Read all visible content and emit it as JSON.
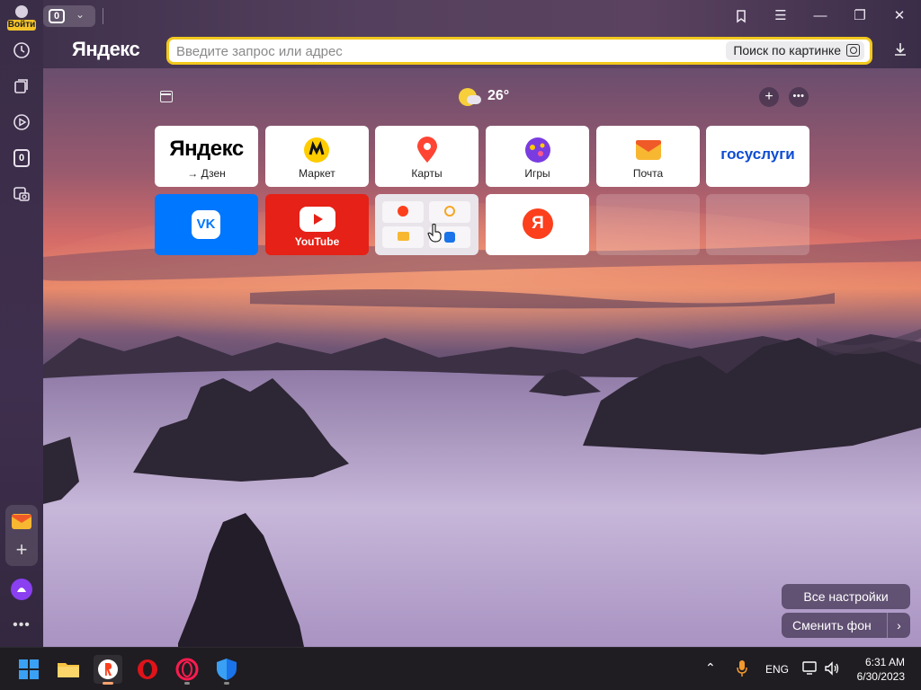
{
  "browser": {
    "login_label": "Войти",
    "tab_count": "0",
    "logo": "Яндекс",
    "search_placeholder": "Введите запрос или адрес",
    "image_search_label": "Поиск по картинке"
  },
  "sidebar": {
    "counter_badge": "0"
  },
  "newtab": {
    "weather_temp": "26°",
    "tiles": [
      {
        "logo": "Яндекс",
        "label": "→ Дзен"
      },
      {
        "label": "Маркет"
      },
      {
        "label": "Карты"
      },
      {
        "label": "Игры"
      },
      {
        "label": "Почта"
      },
      {
        "logo": "госуслуги"
      },
      {
        "logo": "VK"
      },
      {
        "label": "YouTube"
      },
      {
        "folder": "group"
      },
      {
        "logo": "Я"
      },
      {
        "empty": true
      },
      {
        "empty": true
      }
    ],
    "all_settings": "Все настройки",
    "change_bg": "Сменить фон"
  },
  "taskbar": {
    "lang": "ENG",
    "time": "6:31 AM",
    "date": "6/30/2023"
  },
  "colors": {
    "accent": "#f2c81e",
    "youtube_red": "#e62117",
    "vk_blue": "#0077ff",
    "yandex_red": "#fc3f1d"
  }
}
